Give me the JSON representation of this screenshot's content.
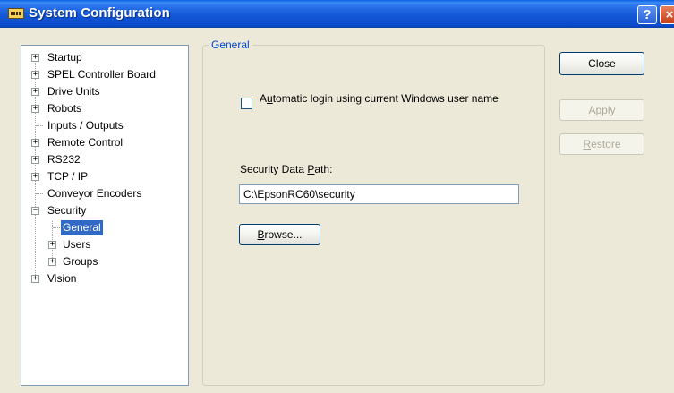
{
  "window": {
    "title": "System Configuration",
    "help_glyph": "?",
    "close_glyph": "×",
    "title_bar_color": "#0b4bcc"
  },
  "tree": {
    "items": [
      {
        "label": "Startup",
        "expander": "+"
      },
      {
        "label": "SPEL Controller Board",
        "expander": "+"
      },
      {
        "label": "Drive Units",
        "expander": "+"
      },
      {
        "label": "Robots",
        "expander": "+"
      },
      {
        "label": "Inputs / Outputs",
        "expander": ""
      },
      {
        "label": "Remote Control",
        "expander": "+"
      },
      {
        "label": "RS232",
        "expander": "+"
      },
      {
        "label": "TCP / IP",
        "expander": "+"
      },
      {
        "label": "Conveyor Encoders",
        "expander": ""
      },
      {
        "label": "Security",
        "expander": "−"
      },
      {
        "label": "General",
        "expander": "",
        "selected": true
      },
      {
        "label": "Users",
        "expander": "+"
      },
      {
        "label": "Groups",
        "expander": "+"
      },
      {
        "label": "Vision",
        "expander": "+"
      }
    ]
  },
  "general": {
    "legend": "General",
    "auto_login": {
      "label_pre": "A",
      "label_accel": "u",
      "label_post": "tomatic login using current Windows user name",
      "checked": false
    },
    "path_label_pre": "Security Data ",
    "path_label_accel": "P",
    "path_label_post": "ath:",
    "path_value": "C:\\EpsonRC60\\security",
    "browse_accel": "B",
    "browse_rest": "rowse..."
  },
  "buttons": {
    "close": "Close",
    "apply_accel": "A",
    "apply_rest": "pply",
    "restore_accel": "R",
    "restore_rest": "estore"
  },
  "colors": {
    "selection": "#316ac5",
    "legend_text": "#0046d5",
    "dialog_bg": "#ece9d8"
  }
}
